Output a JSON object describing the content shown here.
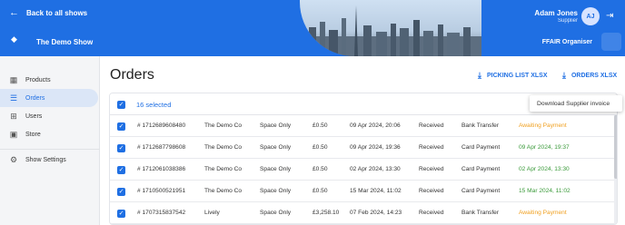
{
  "topbar": {
    "back_label": "Back to all shows",
    "show_name": "The Demo Show",
    "user_name": "Adam Jones",
    "user_role": "Supplier",
    "avatar_initials": "AJ",
    "organiser": "FFAIR Organiser",
    "brand_color": "#1f6fe3"
  },
  "sidebar": {
    "items": [
      {
        "label": "Products",
        "icon": "bag-icon"
      },
      {
        "label": "Orders",
        "icon": "list-icon",
        "active": true
      },
      {
        "label": "Users",
        "icon": "users-table-icon"
      },
      {
        "label": "Store",
        "icon": "store-icon"
      },
      {
        "label": "Show Settings",
        "icon": "gear-icon"
      }
    ]
  },
  "main": {
    "title": "Orders",
    "picking_list_label": "PICKING LIST XLSX",
    "orders_xlsx_label": "ORDERS XLSX",
    "selected_count": "16 selected",
    "context_menu": {
      "item": "Download Supplier invoice"
    },
    "rows": [
      {
        "id": "# 1712689608480",
        "company": "The Demo Co",
        "type": "Space Only",
        "amount": "£0.50",
        "date": "09 Apr 2024, 20:06",
        "status": "Received",
        "method": "Bank Transfer",
        "payment": "Awaiting Payment",
        "payment_color": "#f0a020"
      },
      {
        "id": "# 1712687798608",
        "company": "The Demo Co",
        "type": "Space Only",
        "amount": "£0.50",
        "date": "09 Apr 2024, 19:36",
        "status": "Received",
        "method": "Card Payment",
        "payment": "09 Apr 2024, 19:37",
        "payment_color": "#3a9a3a"
      },
      {
        "id": "# 1712061038386",
        "company": "The Demo Co",
        "type": "Space Only",
        "amount": "£0.50",
        "date": "02 Apr 2024, 13:30",
        "status": "Received",
        "method": "Card Payment",
        "payment": "02 Apr 2024, 13:30",
        "payment_color": "#3a9a3a"
      },
      {
        "id": "# 1710500521951",
        "company": "The Demo Co",
        "type": "Space Only",
        "amount": "£0.50",
        "date": "15 Mar 2024, 11:02",
        "status": "Received",
        "method": "Card Payment",
        "payment": "15 Mar 2024, 11:02",
        "payment_color": "#3a9a3a"
      },
      {
        "id": "# 1707315837542",
        "company": "Lively",
        "type": "Space Only",
        "amount": "£3,258.10",
        "date": "07 Feb 2024, 14:23",
        "status": "Received",
        "method": "Bank Transfer",
        "payment": "Awaiting Payment",
        "payment_color": "#f0a020"
      }
    ]
  }
}
